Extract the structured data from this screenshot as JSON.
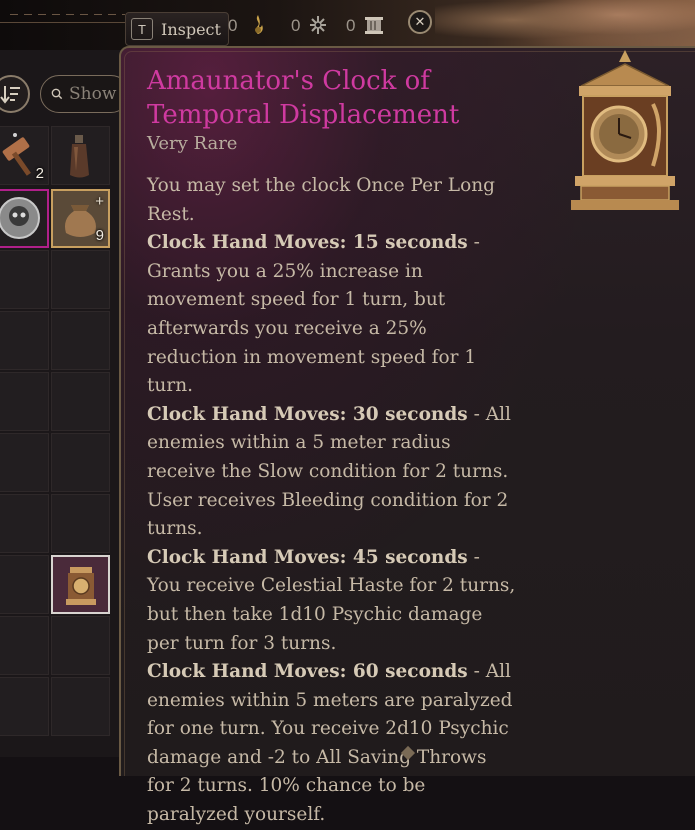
{
  "topbar": {
    "key_hint": "T",
    "inspect_label": "Inspect",
    "counters": [
      {
        "icon": "flame-icon",
        "value": "0"
      },
      {
        "icon": "star-burst-icon",
        "value": "0"
      },
      {
        "icon": "scroll-icon",
        "value": "0"
      }
    ],
    "close_glyph": "✕"
  },
  "inventory": {
    "search": {
      "placeholder": "Show"
    },
    "items": [
      {
        "name": "hammer-item",
        "count": "2"
      },
      {
        "name": "bottle-item",
        "count": ""
      },
      {
        "name": "skull-coin-item",
        "count": ""
      },
      {
        "name": "pouch-item",
        "count": "9",
        "plus": "+"
      },
      {
        "name": "clock-item",
        "count": ""
      }
    ]
  },
  "tooltip": {
    "title": "Amaunator's Clock of Temporal Displacement",
    "rarity": "Very Rare",
    "intro": "You may set the clock Once Per Long Rest.",
    "effects": [
      {
        "lead": "Clock Hand Moves: 15 seconds",
        "text": " - Grants you a 25% increase in movement speed for 1 turn, but afterwards you receive a 25% reduction in movement speed for 1 turn."
      },
      {
        "lead": "Clock Hand Moves: 30 seconds",
        "text": " - All enemies within a 5 meter radius receive the Slow condition for 2 turns. User receives Bleeding condition for 2 turns."
      },
      {
        "lead": "Clock Hand Moves: 45 seconds",
        "text": " - You receive Celestial Haste for 2 turns, but then take 1d10 Psychic damage per turn for 3 turns."
      },
      {
        "lead": "Clock Hand Moves: 60 seconds",
        "text": " - All enemies within 5 meters are paralyzed for one turn. You receive 2d10 Psychic damage and -2 to All Saving Throws for 2 turns. 10% chance to be paralyzed yourself."
      }
    ]
  },
  "colors": {
    "title": "#cf3aa0",
    "rarity_border": "#b0208a",
    "gold": "#c8a060"
  }
}
